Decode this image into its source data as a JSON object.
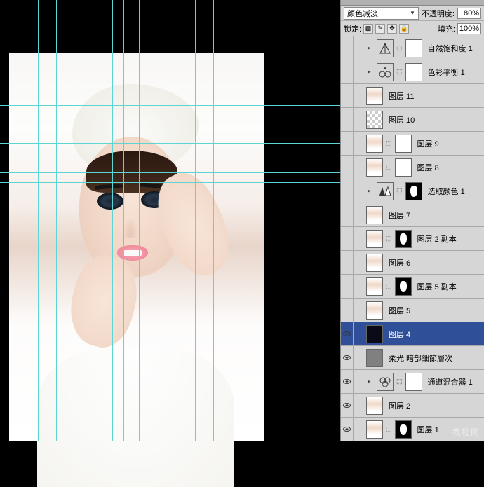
{
  "blend_mode": "颜色减淡",
  "opacity_label": "不透明度:",
  "opacity_value": "80%",
  "lock_label": "锁定:",
  "fill_label": "填充:",
  "fill_value": "100%",
  "watermark": "教程网",
  "guides": {
    "vertical": [
      54,
      80,
      88,
      112,
      160,
      176,
      198,
      236,
      278,
      304
    ],
    "horizontal": [
      150,
      204,
      222,
      232,
      246,
      260,
      436
    ]
  },
  "layers": [
    {
      "visible": false,
      "type": "adjustment",
      "adj": "vibrance",
      "mask": true,
      "name": "自然饱和度 1",
      "expand": true
    },
    {
      "visible": false,
      "type": "adjustment",
      "adj": "colorbalance",
      "mask": true,
      "name": "色彩平衡 1",
      "expand": true
    },
    {
      "visible": false,
      "type": "pixel",
      "thumb": "face",
      "name": "图层 11"
    },
    {
      "visible": false,
      "type": "pixel",
      "thumb": "checker",
      "name": "图层 10"
    },
    {
      "visible": false,
      "type": "pixel",
      "thumb": "face",
      "mask": true,
      "name": "图层 9"
    },
    {
      "visible": false,
      "type": "pixel",
      "thumb": "face",
      "mask": true,
      "name": "图层 8"
    },
    {
      "visible": false,
      "type": "adjustment",
      "adj": "selectivecolor",
      "mask": true,
      "mask_shape": true,
      "name": "选取颜色 1",
      "expand": true
    },
    {
      "visible": false,
      "type": "pixel",
      "thumb": "face",
      "name": "图层 7",
      "underline": true
    },
    {
      "visible": false,
      "type": "pixel",
      "thumb": "face",
      "mask": true,
      "mask_shape": true,
      "name": "图层 2 副本"
    },
    {
      "visible": false,
      "type": "pixel",
      "thumb": "face",
      "name": "图层 6"
    },
    {
      "visible": false,
      "type": "pixel",
      "thumb": "face",
      "mask": true,
      "mask_shape": true,
      "name": "图层 5 副本"
    },
    {
      "visible": false,
      "type": "pixel",
      "thumb": "face",
      "name": "图层 5"
    },
    {
      "visible": true,
      "type": "pixel",
      "thumb": "dark",
      "name": "图层 4",
      "selected": true
    },
    {
      "visible": true,
      "type": "pixel",
      "thumb": "gray",
      "name": "柔光 暗部细節層次"
    },
    {
      "visible": true,
      "type": "adjustment",
      "adj": "channelmixer",
      "mask": true,
      "name": "通道混合器 1",
      "expand": true
    },
    {
      "visible": true,
      "type": "pixel",
      "thumb": "face",
      "name": "图层 2"
    },
    {
      "visible": true,
      "type": "pixel",
      "thumb": "face",
      "mask": true,
      "mask_shape": true,
      "name": "图层 1"
    }
  ]
}
